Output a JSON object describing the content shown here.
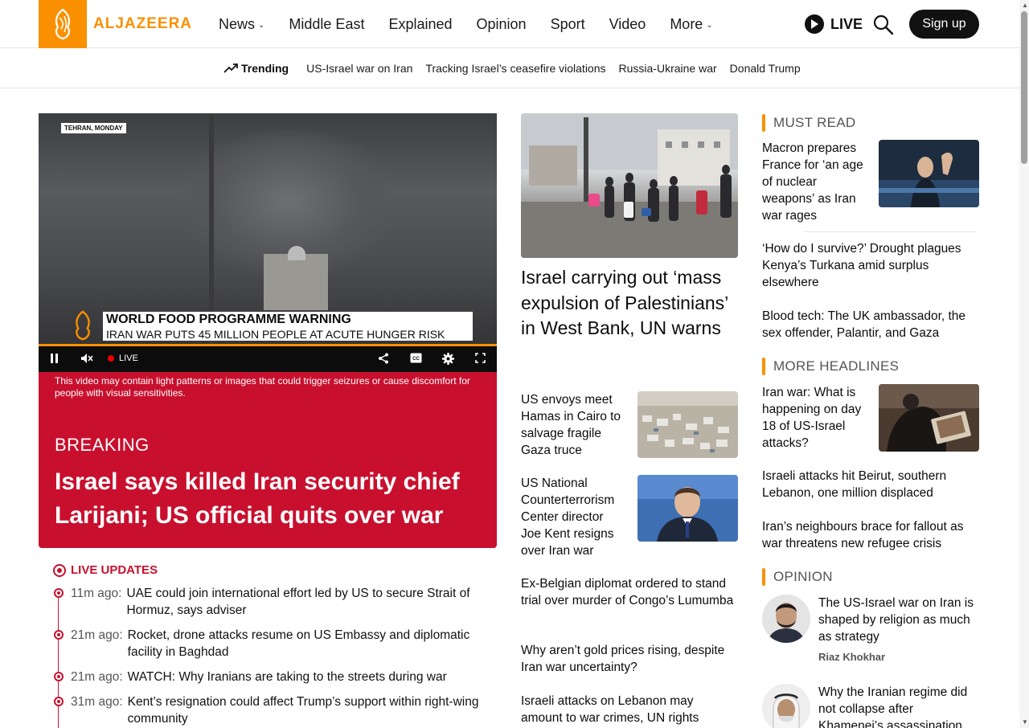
{
  "brand": {
    "name": "ALJAZEERA",
    "accent": "#fa9000",
    "breaking_color": "#c8102e"
  },
  "nav": {
    "items": [
      {
        "label": "News",
        "has_dropdown": true
      },
      {
        "label": "Middle East",
        "has_dropdown": false
      },
      {
        "label": "Explained",
        "has_dropdown": false
      },
      {
        "label": "Opinion",
        "has_dropdown": false
      },
      {
        "label": "Sport",
        "has_dropdown": false
      },
      {
        "label": "Video",
        "has_dropdown": false
      },
      {
        "label": "More",
        "has_dropdown": true
      }
    ],
    "live_label": "LIVE",
    "signup_label": "Sign up"
  },
  "trending": {
    "label": "Trending",
    "links": [
      "US-Israel war on Iran",
      "Tracking Israel’s ceasefire violations",
      "Russia-Ukraine war",
      "Donald Trump"
    ]
  },
  "video": {
    "location_tag": "TEHRAN, MONDAY",
    "headline_top": "WORLD FOOD PROGRAMME WARNING",
    "headline_bottom": "IRAN WAR PUTS 45 MILLION PEOPLE AT ACUTE HUNGER RISK",
    "live_label": "LIVE",
    "warning": "This video may contain light patterns or images that could trigger seizures or cause discomfort for people with visual sensitivities."
  },
  "breaking": {
    "label": "BREAKING",
    "title": "Israel says killed Iran security chief Larijani; US official quits over war"
  },
  "live_updates": {
    "label": "LIVE UPDATES",
    "items": [
      {
        "time": "11m ago:",
        "text": "UAE could join international effort led by US to secure Strait of Hormuz, says adviser"
      },
      {
        "time": "21m ago:",
        "text": "Rocket, drone attacks resume on US Embassy and diplomatic facility in Baghdad"
      },
      {
        "time": "21m ago:",
        "text": "WATCH: Why Iranians are taking to the streets during war"
      },
      {
        "time": "31m ago:",
        "text": "Kent’s resignation could affect Trump’s support within right-wing community"
      }
    ]
  },
  "middle": {
    "lead_title": "Israel carrying out ‘mass expulsion of Palestinians’ in West Bank, UN warns",
    "stories": [
      "US envoys meet Hamas in Cairo to salvage fragile Gaza truce",
      "US National Counterterrorism Center director Joe Kent resigns over Iran war"
    ],
    "links": [
      "Ex-Belgian diplomat ordered to stand trial over murder of Congo’s Lumumba",
      "Why aren’t gold prices rising, despite Iran war uncertainty?",
      "Israeli attacks on Lebanon may amount to war crimes, UN rights"
    ]
  },
  "right": {
    "must_read": {
      "label": "MUST READ",
      "lead": "Macron prepares France for ‘an age of nuclear weapons’ as Iran war rages",
      "links": [
        "‘How do I survive?’ Drought plagues Kenya’s Turkana amid surplus elsewhere",
        "Blood tech: The UK ambassador, the sex offender, Palantir, and Gaza"
      ]
    },
    "more_headlines": {
      "label": "MORE HEADLINES",
      "lead": "Iran war: What is happening on day 18 of US-Israel attacks?",
      "links": [
        "Israeli attacks hit Beirut, southern Lebanon, one million displaced",
        "Iran’s neighbours brace for fallout as war threatens new refugee crisis"
      ]
    },
    "opinion": {
      "label": "OPINION",
      "items": [
        {
          "text": "The US-Israel war on Iran is shaped by religion as much as strategy",
          "author": "Riaz Khokhar"
        },
        {
          "text": "Why the Iranian regime did not collapse after Khamenei’s assassination",
          "author": ""
        }
      ]
    }
  }
}
